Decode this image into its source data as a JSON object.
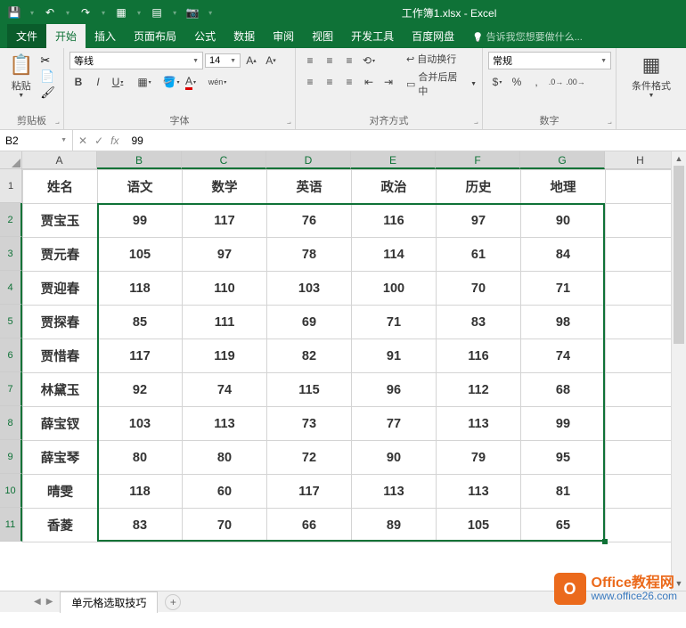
{
  "title": "工作簿1.xlsx - Excel",
  "tabs": {
    "file": "文件",
    "home": "开始",
    "insert": "插入",
    "layout": "页面布局",
    "formula": "公式",
    "data": "数据",
    "review": "审阅",
    "view": "视图",
    "dev": "开发工具",
    "baidu": "百度网盘",
    "tell": "告诉我您想要做什么..."
  },
  "ribbon": {
    "clipboard": {
      "label": "剪贴板",
      "paste": "粘贴"
    },
    "font": {
      "label": "字体",
      "name": "等线",
      "size": "14"
    },
    "align": {
      "label": "对齐方式",
      "wrap": "自动换行",
      "merge": "合并后居中"
    },
    "number": {
      "label": "数字",
      "format": "常规"
    },
    "cond": {
      "label": "条件格式"
    }
  },
  "namebox": "B2",
  "formula": "99",
  "cols": [
    "A",
    "B",
    "C",
    "D",
    "E",
    "F",
    "G",
    "H"
  ],
  "rows": [
    "1",
    "2",
    "3",
    "4",
    "5",
    "6",
    "7",
    "8",
    "9",
    "10",
    "11"
  ],
  "headers": [
    "姓名",
    "语文",
    "数学",
    "英语",
    "政治",
    "历史",
    "地理"
  ],
  "chart_data": {
    "type": "table",
    "columns": [
      "姓名",
      "语文",
      "数学",
      "英语",
      "政治",
      "历史",
      "地理"
    ],
    "rows": [
      {
        "姓名": "贾宝玉",
        "语文": 99,
        "数学": 117,
        "英语": 76,
        "政治": 116,
        "历史": 97,
        "地理": 90
      },
      {
        "姓名": "贾元春",
        "语文": 105,
        "数学": 97,
        "英语": 78,
        "政治": 114,
        "历史": 61,
        "地理": 84
      },
      {
        "姓名": "贾迎春",
        "语文": 118,
        "数学": 110,
        "英语": 103,
        "政治": 100,
        "历史": 70,
        "地理": 71
      },
      {
        "姓名": "贾探春",
        "语文": 85,
        "数学": 111,
        "英语": 69,
        "政治": 71,
        "历史": 83,
        "地理": 98
      },
      {
        "姓名": "贾惜春",
        "语文": 117,
        "数学": 119,
        "英语": 82,
        "政治": 91,
        "历史": 116,
        "地理": 74
      },
      {
        "姓名": "林黛玉",
        "语文": 92,
        "数学": 74,
        "英语": 115,
        "政治": 96,
        "历史": 112,
        "地理": 68
      },
      {
        "姓名": "薛宝钗",
        "语文": 103,
        "数学": 113,
        "英语": 73,
        "政治": 77,
        "历史": 113,
        "地理": 99
      },
      {
        "姓名": "薛宝琴",
        "语文": 80,
        "数学": 80,
        "英语": 72,
        "政治": 90,
        "历史": 79,
        "地理": 95
      },
      {
        "姓名": "晴雯",
        "语文": 118,
        "数学": 60,
        "英语": 117,
        "政治": 113,
        "历史": 113,
        "地理": 81
      },
      {
        "姓名": "香菱",
        "语文": 83,
        "数学": 70,
        "英语": 66,
        "政治": 89,
        "历史": 105,
        "地理": 65
      }
    ]
  },
  "sheet_tab": "单元格选取技巧",
  "watermark": {
    "title": "Office教程网",
    "url": "www.office26.com"
  }
}
